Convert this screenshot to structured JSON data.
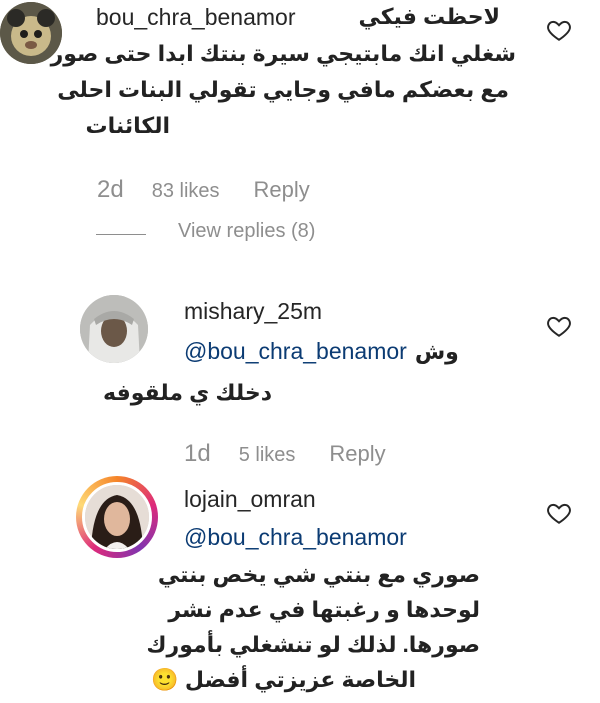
{
  "comments": [
    {
      "username": "bou_chra_benamor",
      "first_line": "لاحظت فيكي",
      "lines": [
        "شغلي انك مابتيجي سيرة بنتك ابدا حتى صور",
        "مع بعضكم مافي وجايي تقولي البنات احلى",
        "الكائنات"
      ],
      "time": "2d",
      "likes": "83 likes",
      "reply": "Reply",
      "view_replies": "View replies (8)"
    },
    {
      "username": "mishary_25m",
      "mention": "@bou_chra_benamor",
      "mention_suffix": "وش",
      "lines": [
        "دخلك ي ملقوفه"
      ],
      "time": "1d",
      "likes": "5 likes",
      "reply": "Reply"
    },
    {
      "username": "lojain_omran",
      "mention": "@bou_chra_benamor",
      "lines": [
        "صوري مع بنتي شي يخص بنتي",
        "لوحدها و رغبتها في عدم نشر",
        "صورها. لذلك لو تنشغلي بأمورك",
        "الخاصة عزيزتي أفضل 🙂"
      ]
    }
  ]
}
